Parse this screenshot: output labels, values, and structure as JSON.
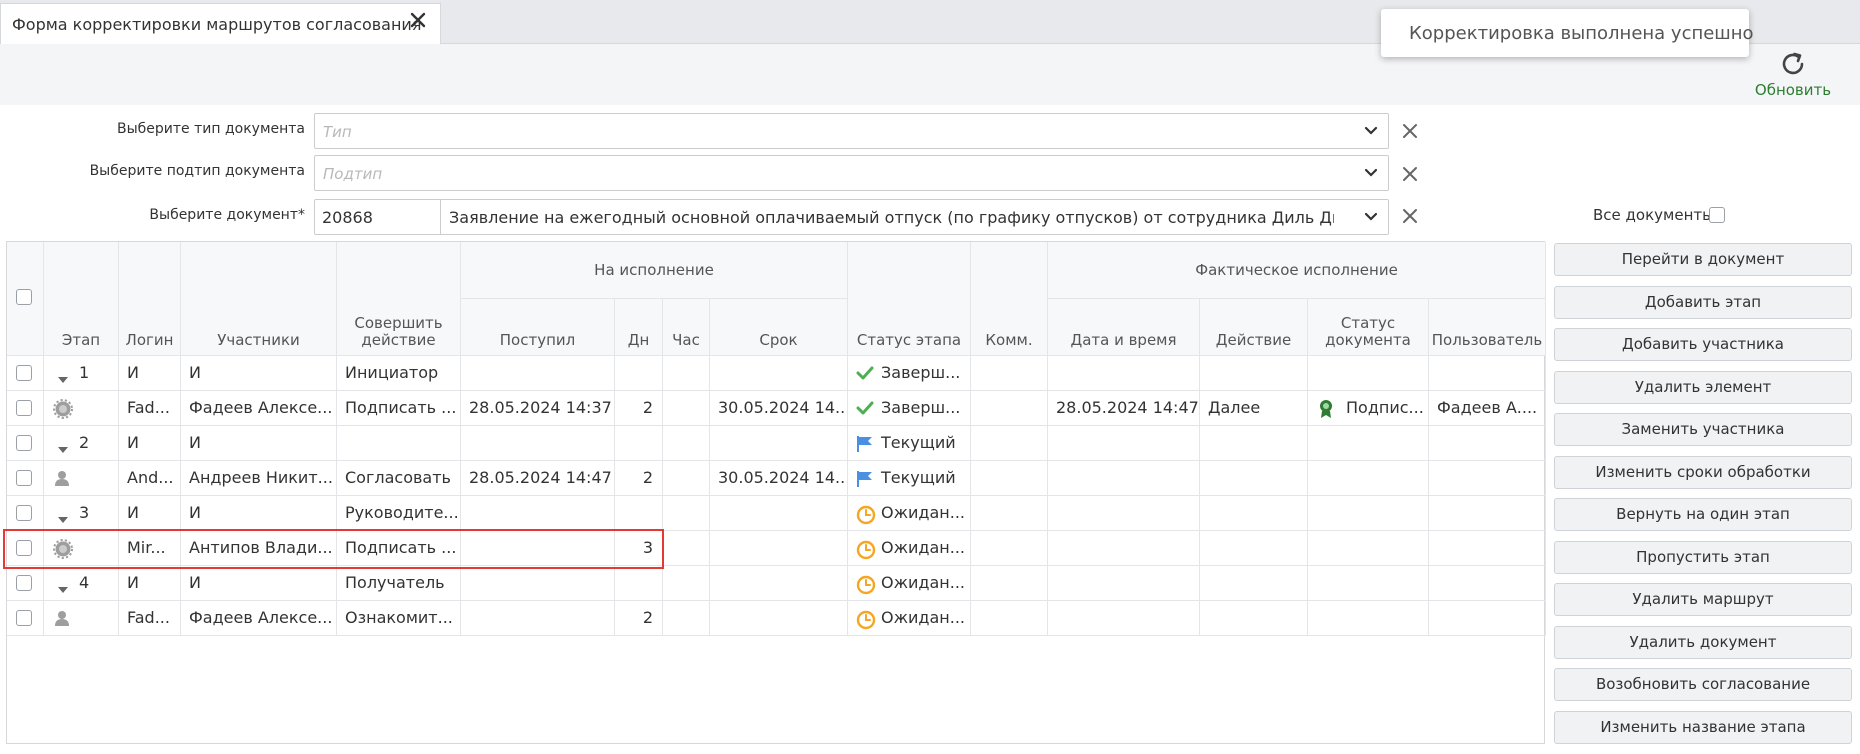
{
  "tab": {
    "title": "Форма корректировки маршрутов согласования"
  },
  "toast": {
    "message": "Корректировка выполнена успешно"
  },
  "toolbar": {
    "refresh_label": "Обновить"
  },
  "filters": {
    "doc_type": {
      "label": "Выберите тип документа",
      "placeholder": "Тип"
    },
    "doc_subtype": {
      "label": "Выберите подтип документа",
      "placeholder": "Подтип"
    },
    "document": {
      "label": "Выберите документ*",
      "id": "20868",
      "name": "Заявление на ежегодный основной оплачиваемый отпуск (по графику отпусков) от сотрудника Диль Дили Шами."
    }
  },
  "all_documents_label": "Все документы",
  "grid": {
    "group_headers": {
      "execution": "На исполнение",
      "actual": "Фактическое исполнение"
    },
    "headers": {
      "stage": "Этап",
      "login": "Логин",
      "participants": "Участники",
      "action": "Совершить действие",
      "received": "Поступил",
      "days": "Дн",
      "hours": "Час",
      "deadline": "Срок",
      "stage_status": "Статус этапа",
      "comments": "Комм.",
      "datetime": "Дата и время",
      "act": "Действие",
      "doc_status": "Статус документа",
      "user": "Пользователь"
    },
    "rows": [
      {
        "kind": "stage",
        "stage": "1",
        "login": "И",
        "participant": "И",
        "action": "Инициатор",
        "received": "",
        "days": "",
        "hours": "",
        "deadline": "",
        "status_icon": "check-icon",
        "status": "Заверш...",
        "comm": "",
        "datetime": "",
        "act": "",
        "doc_status": "",
        "user": ""
      },
      {
        "kind": "gear",
        "stage": "",
        "login": "Fad...",
        "participant": "Фадеев Алексе...",
        "action": "Подписать ...",
        "received": "28.05.2024 14:37",
        "days": "2",
        "hours": "",
        "deadline": "30.05.2024 14...",
        "status_icon": "check-icon",
        "status": "Заверш...",
        "comm": "",
        "datetime": "28.05.2024 14:47",
        "act": "Далее",
        "doc_status": "Подпис...",
        "user": "Фадеев А...."
      },
      {
        "kind": "stage",
        "stage": "2",
        "login": "И",
        "participant": "И",
        "action": "",
        "received": "",
        "days": "",
        "hours": "",
        "deadline": "",
        "status_icon": "flag-icon",
        "status": "Текущий",
        "comm": "",
        "datetime": "",
        "act": "",
        "doc_status": "",
        "user": ""
      },
      {
        "kind": "person",
        "stage": "",
        "login": "And...",
        "participant": "Андреев Никит...",
        "action": "Согласовать",
        "received": "28.05.2024 14:47",
        "days": "2",
        "hours": "",
        "deadline": "30.05.2024 14...",
        "status_icon": "flag-icon",
        "status": "Текущий",
        "comm": "",
        "datetime": "",
        "act": "",
        "doc_status": "",
        "user": ""
      },
      {
        "kind": "stage",
        "stage": "3",
        "login": "И",
        "participant": "И",
        "action": "Руководите...",
        "received": "",
        "days": "",
        "hours": "",
        "deadline": "",
        "status_icon": "clock-icon",
        "status": "Ожидан...",
        "comm": "",
        "datetime": "",
        "act": "",
        "doc_status": "",
        "user": ""
      },
      {
        "kind": "gear",
        "stage": "",
        "login": "Mir...",
        "participant": "Антипов Влади...",
        "action": "Подписать ...",
        "received": "",
        "days": "3",
        "hours": "",
        "deadline": "",
        "status_icon": "clock-icon",
        "status": "Ожидан...",
        "comm": "",
        "datetime": "",
        "act": "",
        "doc_status": "",
        "user": ""
      },
      {
        "kind": "stage",
        "stage": "4",
        "login": "И",
        "participant": "И",
        "action": "Получатель",
        "received": "",
        "days": "",
        "hours": "",
        "deadline": "",
        "status_icon": "clock-icon",
        "status": "Ожидан...",
        "comm": "",
        "datetime": "",
        "act": "",
        "doc_status": "",
        "user": ""
      },
      {
        "kind": "person",
        "stage": "",
        "login": "Fad...",
        "participant": "Фадеев Алексе...",
        "action": "Ознакомит...",
        "received": "",
        "days": "2",
        "hours": "",
        "deadline": "",
        "status_icon": "clock-icon",
        "status": "Ожидан...",
        "comm": "",
        "datetime": "",
        "act": "",
        "doc_status": "",
        "user": ""
      }
    ]
  },
  "actions": [
    "Перейти в документ",
    "Добавить этап",
    "Добавить участника",
    "Удалить элемент",
    "Заменить участника",
    "Изменить сроки обработки",
    "Вернуть на один этап",
    "Пропустить этап",
    "Удалить маршрут",
    "Удалить документ",
    "Возобновить согласование",
    "Изменить название этапа"
  ],
  "colors": {
    "accent_green": "#2e7d32",
    "check_green": "#4caf50",
    "flag_blue": "#4a90e2",
    "clock_orange": "#f5a623",
    "highlight_red": "#e53935"
  }
}
